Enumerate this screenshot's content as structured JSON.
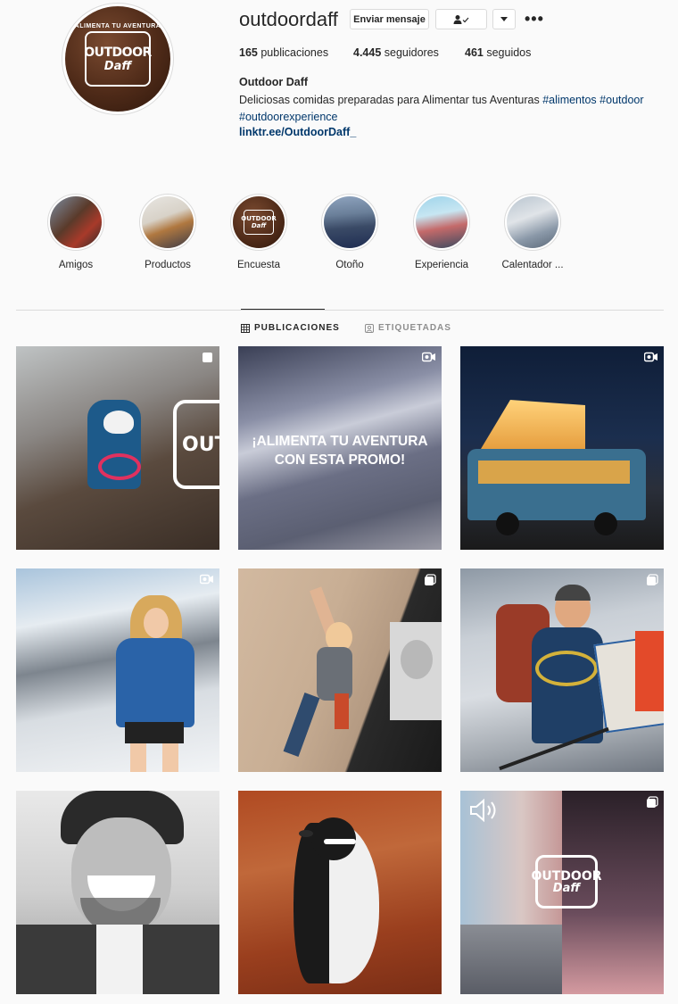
{
  "profile": {
    "username": "outdoordaff",
    "avatar_text_top": "ALIMENTA TU AVENTURA",
    "avatar_text_main": "OUTDOOR",
    "avatar_text_sub": "Daff",
    "buttons": {
      "message": "Enviar mensaje"
    },
    "stats": {
      "posts_count": "165",
      "posts_label": "publicaciones",
      "followers_count": "4.445",
      "followers_label": "seguidores",
      "following_count": "461",
      "following_label": "seguidos"
    },
    "full_name": "Outdoor Daff",
    "bio_text": "Deliciosas comidas preparadas para Alimentar tus Aventuras",
    "bio_tags": [
      "#alimentos",
      "#outdoor",
      "#outdoorexperience"
    ],
    "link": "linktr.ee/OutdoorDaff_"
  },
  "highlights": [
    {
      "label": "Amigos"
    },
    {
      "label": "Productos"
    },
    {
      "label": "Encuesta"
    },
    {
      "label": "Otoño"
    },
    {
      "label": "Experiencia"
    },
    {
      "label": "Calentador ..."
    }
  ],
  "tabs": [
    {
      "label": "PUBLICACIONES",
      "active": true,
      "icon": "grid-icon"
    },
    {
      "label": "ETIQUETADAS",
      "active": false,
      "icon": "tagged-icon"
    }
  ],
  "posts": [
    {
      "icon": "carousel-icon",
      "overlay": "ALIMENTA TU AVENTURA OUTDOOR Daff"
    },
    {
      "icon": "video-icon",
      "overlay": "¡ALIMENTA TU AVENTURA CON ESTA PROMO!"
    },
    {
      "icon": "video-icon",
      "overlay": ""
    },
    {
      "icon": "video-icon",
      "overlay": ""
    },
    {
      "icon": "carousel-icon",
      "overlay": ""
    },
    {
      "icon": "carousel-icon",
      "overlay": ""
    },
    {
      "icon": "",
      "overlay": ""
    },
    {
      "icon": "",
      "overlay": ""
    },
    {
      "icon": "carousel-icon",
      "overlay": "ALIMENTA TU AVENTURA OUTDOOR Daff"
    }
  ],
  "colors": {
    "link": "#00376b",
    "border": "#dbdbdb",
    "background": "#fafafa",
    "text": "#262626",
    "muted": "#8e8e8e"
  }
}
